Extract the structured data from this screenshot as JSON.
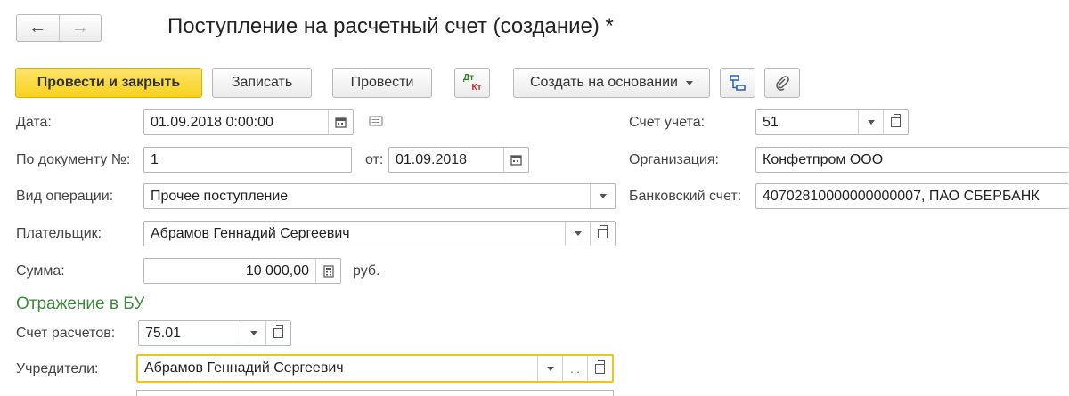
{
  "header": {
    "title": "Поступление на расчетный счет (создание) *",
    "back_icon": "←",
    "forward_icon": "→"
  },
  "toolbar": {
    "post_close_label": "Провести и закрыть",
    "save_label": "Записать",
    "post_label": "Провести",
    "dt_kt_line1": "Дт",
    "dt_kt_line2": "Кт",
    "create_based_label": "Создать на основании",
    "more_dots": "..."
  },
  "form": {
    "date_label": "Дата:",
    "date_value": "01.09.2018  0:00:00",
    "doc_number_label": "По документу №:",
    "doc_number_value": "1",
    "from_label": "от:",
    "from_value": "01.09.2018",
    "operation_label": "Вид операции:",
    "operation_value": "Прочее поступление",
    "payer_label": "Плательщик:",
    "payer_value": "Абрамов Геннадий Сергеевич",
    "amount_label": "Сумма:",
    "amount_value": "10 000,00",
    "currency": "руб.",
    "account_label": "Счет учета:",
    "account_value": "51",
    "org_label": "Организация:",
    "org_value": "Конфетпром ООО",
    "bank_label": "Банковский счет:",
    "bank_value": "40702810000000000007, ПАО СБЕРБАНК"
  },
  "bu_section": {
    "title": "Отражение в БУ",
    "settlement_label": "Счет расчетов:",
    "settlement_value": "75.01",
    "founders_label": "Учредители:",
    "founders_value": "Абрамов Геннадий Сергеевич"
  },
  "colors": {
    "primary_button": "#f7d21c",
    "section_title": "#3a8a3a",
    "active_field_border": "#f0c419"
  }
}
